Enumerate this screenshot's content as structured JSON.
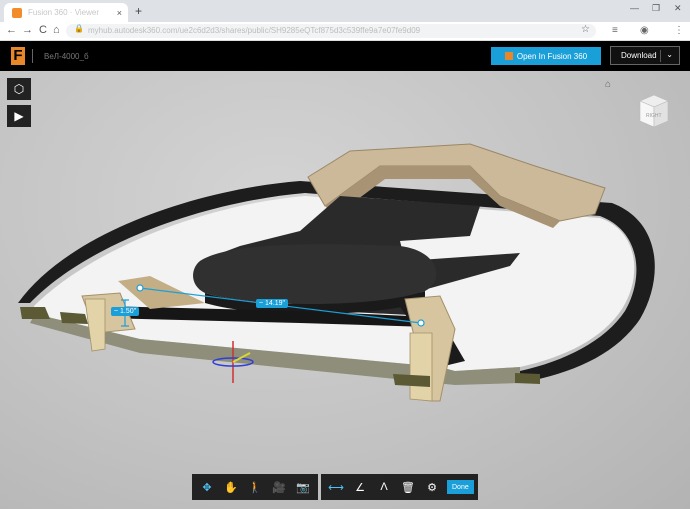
{
  "browser": {
    "tab_title": "Fusion 360 · Viewer",
    "tab_close": "×",
    "new_tab": "+",
    "win_min": "—",
    "win_max": "❐",
    "win_close": "✕",
    "back": "←",
    "forward": "→",
    "reload": "C",
    "home": "⌂",
    "lock": "🔒",
    "url": "myhub.autodesk360.com/ue2c6d2d3/shares/public/SH9285eQTcf875d3c539ffe9a7e07fe9d09",
    "star": "☆",
    "ext1": "≡",
    "ext2": "◉",
    "menu": "⋮"
  },
  "appbar": {
    "logo": "F",
    "document_name": "ВеЛ-4000_б",
    "open_label": "Open In Fusion 360",
    "download_label": "Download",
    "download_chevron": "⌄"
  },
  "viewport": {
    "left_tools": [
      "⬡",
      "▶"
    ],
    "home_icon": "⌂",
    "viewcube_label": "RIGHT",
    "dim_vertical": "~ 1.50\"",
    "dim_horizontal": "~ 14.19\""
  },
  "bottom_toolbar": {
    "nav_tools": [
      {
        "name": "orbit-tool",
        "glyph": "✥"
      },
      {
        "name": "pan-tool",
        "glyph": "✋"
      },
      {
        "name": "walk-tool",
        "glyph": "🚶"
      },
      {
        "name": "camera-tool",
        "glyph": "🎥"
      },
      {
        "name": "snapshot-tool",
        "glyph": "📷"
      }
    ],
    "measure_tools": [
      {
        "name": "measure-distance-tool",
        "glyph": "⟷"
      },
      {
        "name": "measure-angle-tool",
        "glyph": "∠"
      },
      {
        "name": "measure-tool",
        "glyph": "Λ"
      },
      {
        "name": "delete-measure-tool",
        "glyph": "🗑"
      },
      {
        "name": "settings-tool",
        "glyph": "⚙"
      }
    ],
    "done_label": "Done"
  },
  "colors": {
    "accent": "#1a9fd8",
    "brand": "#e8862a",
    "appbar": "#000000"
  }
}
